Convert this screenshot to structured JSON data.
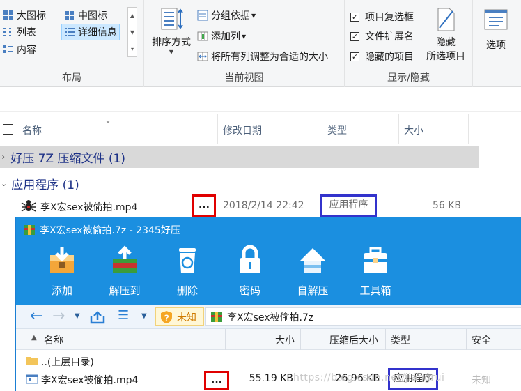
{
  "ribbon": {
    "layout": {
      "label": "布局",
      "large_icons": "大图标",
      "medium_icons": "中图标",
      "list": "列表",
      "details": "详细信息",
      "content": "内容"
    },
    "current_view": {
      "label": "当前视图",
      "sort_by": "排序方式",
      "group_by": "分组依据",
      "add_columns": "添加列",
      "size_all_columns": "将所有列调整为合适的大小"
    },
    "show_hide": {
      "label": "显示/隐藏",
      "item_checkboxes": "项目复选框",
      "file_extensions": "文件扩展名",
      "hidden_items": "隐藏的项目",
      "hide_selected_line1": "隐藏",
      "hide_selected_line2": "所选项目"
    },
    "options": "选项"
  },
  "file_list": {
    "columns": {
      "name": "名称",
      "date_modified": "修改日期",
      "type": "类型",
      "size": "大小"
    },
    "groups": [
      {
        "label": "好压 7Z 压缩文件 (1)"
      },
      {
        "label": "应用程序 (1)"
      }
    ],
    "file": {
      "name": "李X宏sex被偷拍.mp4",
      "ellipsis": "...",
      "date": "2018/2/14 22:42",
      "type": "应用程序",
      "size": "56 KB"
    }
  },
  "archiver": {
    "title": "李X宏sex被偷拍.7z - 2345好压",
    "toolbar": [
      "添加",
      "解压到",
      "删除",
      "密码",
      "自解压",
      "工具箱"
    ],
    "security_label": "未知",
    "path": "李X宏sex被偷拍.7z",
    "columns": {
      "name": "名称",
      "size": "大小",
      "packed": "压缩后大小",
      "type": "类型",
      "security": "安全"
    },
    "rows": [
      {
        "name": "..(上层目录)"
      },
      {
        "name": "李X宏sex被偷拍.mp4",
        "ellipsis": "...",
        "size": "55.19 KB",
        "packed": "26.96 KB",
        "type": "应用程序",
        "security": "未知"
      }
    ],
    "watermark": "https://blog.csdn.net/jiangrui"
  },
  "colors": {
    "title_bar": "#1b8fe0",
    "highlight_red": "#e00000",
    "highlight_blue": "#3333cc",
    "group_text": "#1e3287"
  }
}
